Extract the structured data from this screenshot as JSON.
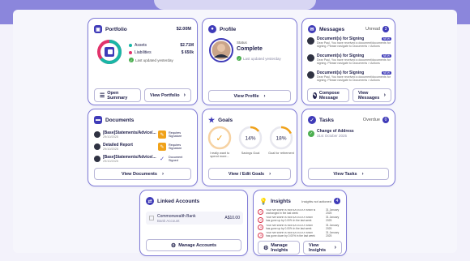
{
  "portfolio": {
    "title": "Portfolio",
    "total": "$2.00M",
    "assets_label": "Assets",
    "assets_value": "$2.71M",
    "liabilities_label": "Liabilities",
    "liabilities_value": "$ 650k",
    "updated": "Last updated yesterday",
    "open_summary": "Open Summary",
    "view_portfolio": "View Portfolio"
  },
  "profile": {
    "title": "Profile",
    "status_label": "Status",
    "status_value": "Complete",
    "updated": "Last updated yesterday",
    "view_profile": "View Profile"
  },
  "messages": {
    "title": "Messages",
    "unread_label": "Unread",
    "unread_count": "3",
    "items": [
      {
        "title": "Document(s) for Signing",
        "badge": "NEW",
        "body": "Dear Paul, You have received a document/documents for signing. Please navigate to Documents > Actions"
      },
      {
        "title": "Document(s) for Signing",
        "badge": "NEW",
        "body": "Dear Paul, You have received a document/documents for signing. Please navigate to Documents > Actions"
      },
      {
        "title": "Document(s) for Signing",
        "badge": "NEW",
        "body": "Dear Paul, You have received a document/documents for signing. Please navigate to Documents > Actions"
      }
    ],
    "compose": "Compose Message",
    "view_messages": "View Messages"
  },
  "documents": {
    "title": "Documents",
    "items": [
      {
        "name": "[Base]Statements/Advice/...",
        "date": "29/10/2025",
        "status": "Requires Signature"
      },
      {
        "name": "Detailed Report",
        "date": "29/10/2025",
        "status": "Requires Signature"
      },
      {
        "name": "[Base]Statements/Advice/...",
        "date": "29/10/2025",
        "status": "Document Signed"
      }
    ],
    "view_documents": "View Documents"
  },
  "goals": {
    "title": "Goals",
    "items": [
      {
        "value": "",
        "label": "I really want to spend more...",
        "fraction": 0.0
      },
      {
        "value": "14%",
        "label": "Savings Goal",
        "fraction": 0.14
      },
      {
        "value": "18%",
        "label": "Goal for retirement",
        "fraction": 0.18
      }
    ],
    "view_edit": "View / Edit Goals"
  },
  "tasks": {
    "title": "Tasks",
    "overdue_label": "Overdue",
    "overdue_count": "0",
    "items": [
      {
        "title": "Change of Address",
        "date": "31st October 2025"
      }
    ],
    "view_tasks": "View Tasks"
  },
  "linked": {
    "title": "Linked Accounts",
    "bank_name": "Commonwealth Bank",
    "bank_sub": "Bank Account",
    "bank_value": "A$10.00",
    "manage": "Manage Accounts"
  },
  "insights": {
    "title": "Insights",
    "unread_label": "Insights not actioned",
    "unread_count": "4",
    "items": [
      {
        "text": "Your Net Worth is now $XXXXXX which is unchanged in the last week",
        "date": "31 January 2025"
      },
      {
        "text": "Your Net Worth is now $XXXXXX which has gone up by 0.00% in the last week",
        "date": "31 January 2025"
      },
      {
        "text": "Your Net Worth is now $XXXXXX which has gone up by 0.00% in the last week",
        "date": "31 January 2025"
      },
      {
        "text": "Your Net Worth is now $XXXXXX which has gone down by 0.00% in the last week",
        "date": "31 January 2025"
      }
    ],
    "manage": "Manage Insights",
    "view": "View Insights"
  },
  "colors": {
    "accent": "#3f3bb8",
    "border": "#7f7ad6",
    "banner": "#8b86dc",
    "success": "#4caf50",
    "warning": "#f0a21a",
    "insight": "#d9334a"
  }
}
